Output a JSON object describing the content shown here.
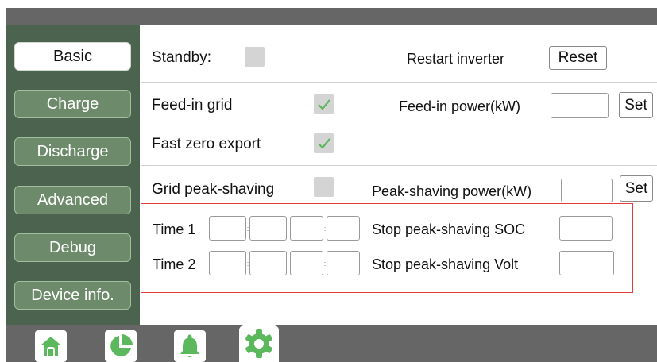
{
  "sidebar": {
    "items": [
      {
        "label": "Basic",
        "active": true
      },
      {
        "label": "Charge",
        "active": false
      },
      {
        "label": "Discharge",
        "active": false
      },
      {
        "label": "Advanced",
        "active": false
      },
      {
        "label": "Debug",
        "active": false
      },
      {
        "label": "Device info.",
        "active": false
      }
    ]
  },
  "settings": {
    "standby": {
      "label": "Standby:",
      "checked": false
    },
    "restart": {
      "label": "Restart inverter",
      "button": "Reset"
    },
    "feed_in_grid": {
      "label": "Feed-in grid",
      "checked": true
    },
    "feed_in_power": {
      "label": "Feed-in power(kW)",
      "value": "",
      "button": "Set"
    },
    "fast_zero_export": {
      "label": "Fast zero export",
      "checked": true
    },
    "grid_peak_shaving": {
      "label": "Grid peak-shaving",
      "checked": false
    },
    "peak_shaving_power": {
      "label": "Peak-shaving power(kW)",
      "value": "",
      "button": "Set"
    },
    "time1": {
      "label": "Time 1"
    },
    "time2": {
      "label": "Time 2"
    },
    "stop_soc": {
      "label": "Stop peak-shaving SOC",
      "value": ""
    },
    "stop_volt": {
      "label": "Stop peak-shaving Volt",
      "value": ""
    }
  },
  "bottom_nav": [
    {
      "icon": "home-icon",
      "active": false
    },
    {
      "icon": "pie-chart-icon",
      "active": false
    },
    {
      "icon": "bell-icon",
      "active": false
    },
    {
      "icon": "gear-icon",
      "active": true
    }
  ],
  "colors": {
    "accent": "#5cb85c",
    "sidebar": "#4c634f",
    "highlight_border": "#e43a3a"
  }
}
